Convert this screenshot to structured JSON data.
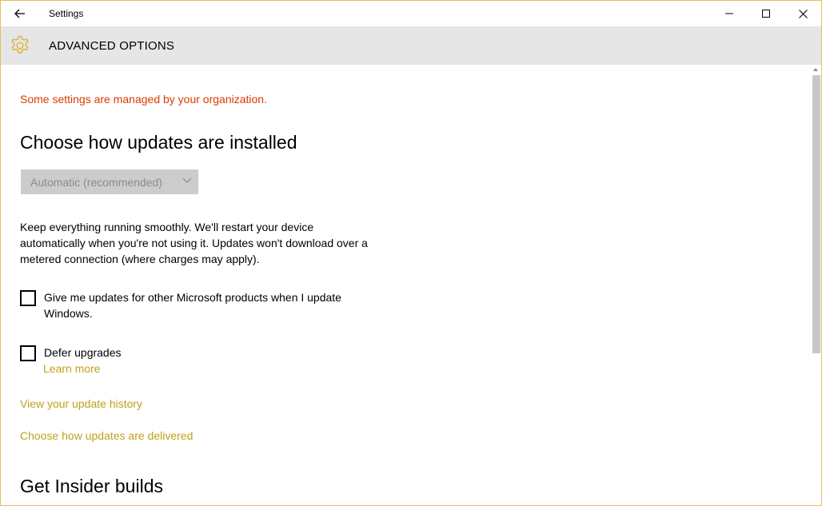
{
  "window": {
    "app_title": "Settings",
    "back_icon": "arrow-left-icon",
    "minimize_icon": "minimize-icon",
    "maximize_icon": "maximize-icon",
    "close_icon": "close-icon",
    "border_color": "#e2c15a"
  },
  "header": {
    "icon": "gear-icon",
    "title": "ADVANCED OPTIONS",
    "background": "#e6e6e6",
    "icon_color": "#d9b02c"
  },
  "main": {
    "managed_notice": "Some settings are managed by your organization.",
    "install_heading": "Choose how updates are installed",
    "install_dropdown": {
      "selected": "Automatic (recommended)",
      "disabled": true
    },
    "install_description": "Keep everything running smoothly. We'll restart your device automatically when you're not using it. Updates won't download over a metered connection (where charges may apply).",
    "checkbox_other_products": {
      "label": "Give me updates for other Microsoft products when I update Windows.",
      "checked": false
    },
    "checkbox_defer": {
      "label": "Defer upgrades",
      "checked": false
    },
    "learn_more": "Learn more",
    "update_history_link": "View your update history",
    "delivery_link": "Choose how updates are delivered",
    "insider_heading": "Get Insider builds"
  },
  "colors": {
    "warning": "#d83b01",
    "link": "#c0a11b",
    "dropdown_bg": "#cccccc",
    "dropdown_text": "#8a8a8a"
  }
}
